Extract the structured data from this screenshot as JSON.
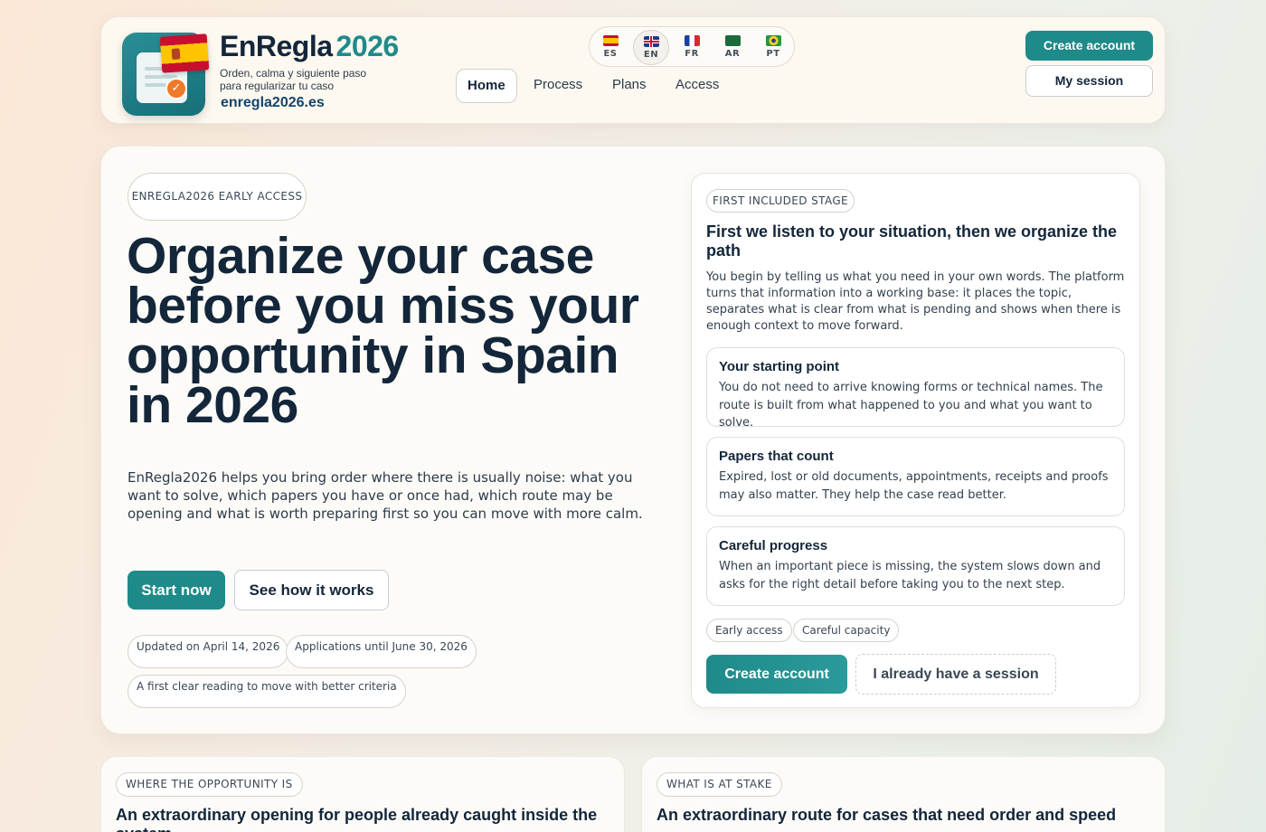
{
  "brand": {
    "name": "EnRegla",
    "year": "2026",
    "tagline": "Orden, calma y siguiente paso para regularizar tu caso",
    "domain": "enregla2026.es"
  },
  "languages": [
    {
      "code": "ES",
      "active": false
    },
    {
      "code": "EN",
      "active": true
    },
    {
      "code": "FR",
      "active": false
    },
    {
      "code": "AR",
      "active": false
    },
    {
      "code": "PT",
      "active": false
    }
  ],
  "nav": {
    "home": "Home",
    "process": "Process",
    "plans": "Plans",
    "access": "Access"
  },
  "header_actions": {
    "create_account": "Create account",
    "my_session": "My session"
  },
  "hero": {
    "eyebrow": "ENREGLA2026 EARLY ACCESS",
    "title": "Organize your case before you miss your opportunity in Spain in 2026",
    "description": "EnRegla2026 helps you bring order where there is usually noise: what you want to solve, which papers you have or once had, which route may be opening and what is worth preparing first so you can move with more calm.",
    "start_label": "Start now",
    "how_label": "See how it works",
    "meta": {
      "updated": "Updated on April 14, 2026",
      "applications": "Applications until June 30, 2026",
      "reading": "A first clear reading to move with better criteria"
    }
  },
  "stage": {
    "eyebrow": "FIRST INCLUDED STAGE",
    "title": "First we listen to your situation, then we organize the path",
    "description": "You begin by telling us what you need in your own words. The platform turns that information into a working base: it places the topic, separates what is clear from what is pending and shows when there is enough context to move forward.",
    "points": [
      {
        "title": "Your starting point",
        "text": "You do not need to arrive knowing forms or technical names. The route is built from what happened to you and what you want to solve."
      },
      {
        "title": "Papers that count",
        "text": "Expired, lost or old documents, appointments, receipts and proofs may also matter. They help the case read better."
      },
      {
        "title": "Careful progress",
        "text": "When an important piece is missing, the system slows down and asks for the right detail before taking you to the next step."
      }
    ],
    "tags": {
      "early": "Early access",
      "capacity": "Careful capacity"
    },
    "create_account": "Create account",
    "have_session": "I already have a session"
  },
  "bottom": {
    "left": {
      "eyebrow": "WHERE THE OPPORTUNITY IS",
      "title": "An extraordinary opening for people already caught inside the system"
    },
    "right": {
      "eyebrow": "WHAT IS AT STAKE",
      "title": "An extraordinary route for cases that need order and speed"
    }
  },
  "colors": {
    "accent": "#1f8a8a",
    "navy": "#13263a",
    "check_orange": "#ef7a2a"
  }
}
